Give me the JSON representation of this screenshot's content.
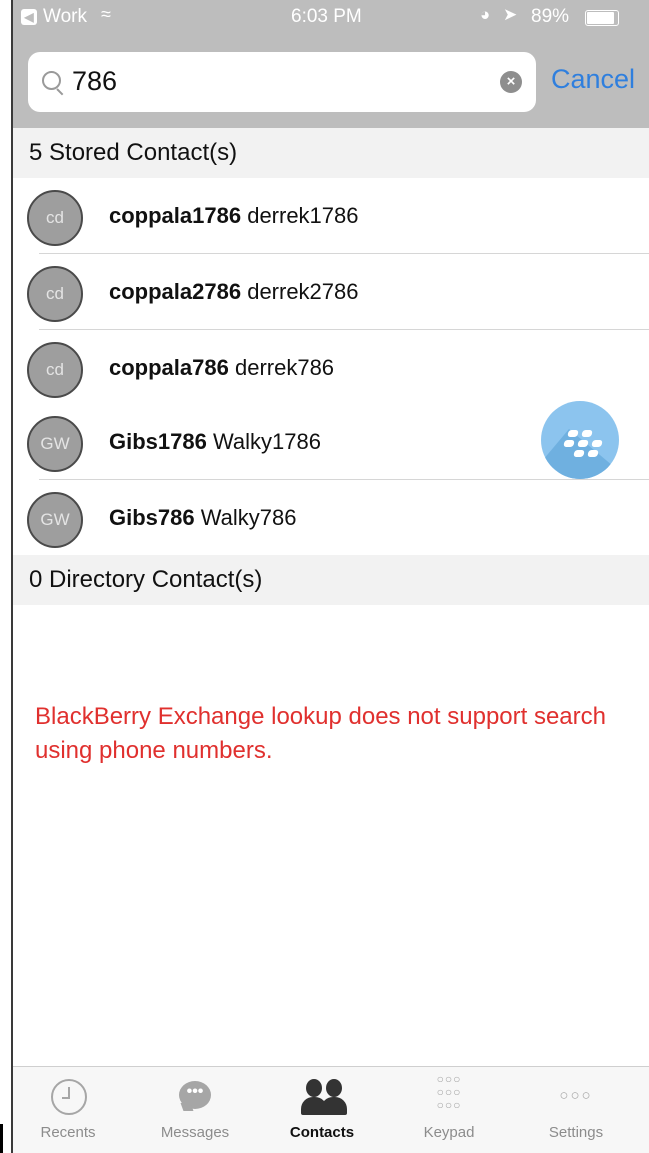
{
  "status_bar": {
    "carrier": "Work",
    "time": "6:03 PM",
    "battery": "89%",
    "battery_level": 0.89
  },
  "search": {
    "query": "786",
    "cancel_label": "Cancel"
  },
  "stored_section": {
    "title": "5 Stored Contact(s)",
    "contacts": [
      {
        "initials": "cd",
        "first": "coppala1786",
        "last": "derrek1786"
      },
      {
        "initials": "cd",
        "first": "coppala2786",
        "last": "derrek2786"
      },
      {
        "initials": "cd",
        "first": "coppala786",
        "last": "derrek786"
      },
      {
        "initials": "GW",
        "first": "Gibs1786",
        "last": "Walky1786"
      },
      {
        "initials": "GW",
        "first": "Gibs786",
        "last": "Walky786"
      }
    ]
  },
  "directory_section": {
    "title": "0 Directory Contact(s)",
    "notice": "BlackBerry Exchange lookup does not support search using phone numbers."
  },
  "tabs": [
    {
      "label": "Recents",
      "icon": "clock-icon"
    },
    {
      "label": "Messages",
      "icon": "chat-bubble-icon"
    },
    {
      "label": "Contacts",
      "icon": "contacts-icon",
      "active": true
    },
    {
      "label": "Keypad",
      "icon": "keypad-icon"
    },
    {
      "label": "Settings",
      "icon": "more-icon"
    }
  ],
  "colors": {
    "accent": "#2f7fde",
    "notice": "#e0302e",
    "header_bg": "#bdbdbd",
    "bb_logo": "#8cc4ee"
  }
}
